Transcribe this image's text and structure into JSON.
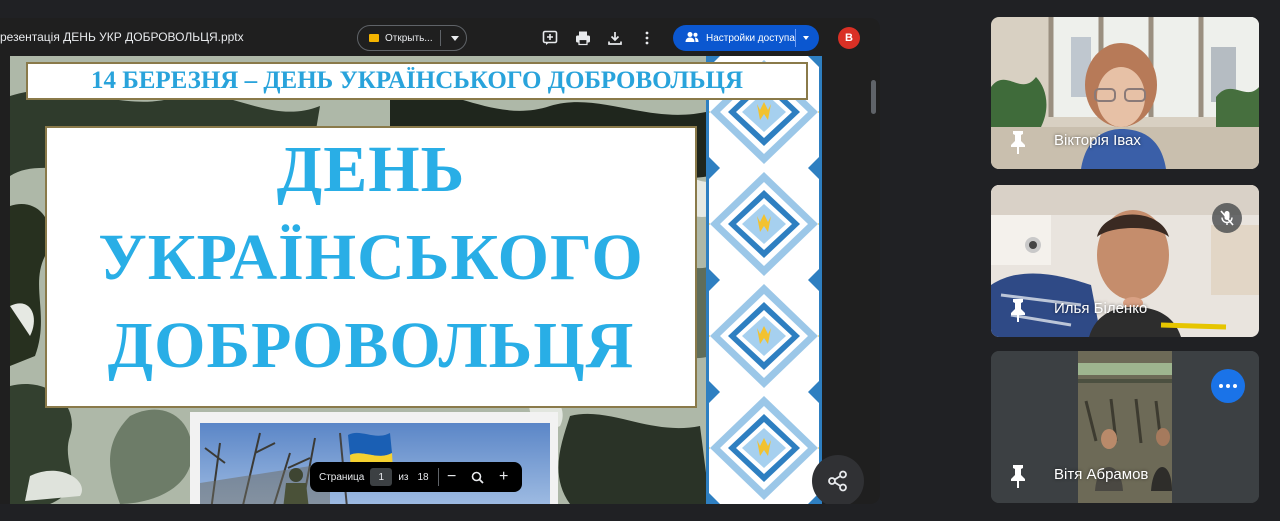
{
  "viewer": {
    "file_name": "резентація ДЕНЬ УКР ДОБРОВОЛЬЦЯ.pptx",
    "open_button_label": "Открыть...",
    "share_access_label": "Настройки доступа",
    "avatar_letter": "B",
    "icons": [
      "add-comment-icon",
      "print-icon",
      "download-icon",
      "more-vert-icon",
      "people-icon",
      "share-icon"
    ]
  },
  "slide": {
    "banner": "14 БЕРЕЗНЯ – ДЕНЬ УКРАЇНСЬКОГО ДОБРОВОЛЬЦЯ",
    "title_line_1": "ДЕНЬ",
    "title_line_2": "УКРАЇНСЬКОГО",
    "title_line_3": "ДОБРОВОЛЬЦЯ"
  },
  "page_control": {
    "label": "Страница",
    "current_page": "1",
    "of_label": "из",
    "total_pages": "18",
    "zoom_out": "−",
    "zoom_in": "+"
  },
  "participants": [
    {
      "name": "Вікторія Івах"
    },
    {
      "name": "Илья Біленко",
      "muted": true
    },
    {
      "name": "Вітя Абрамов"
    }
  ],
  "colors": {
    "accent": "#0b57d0",
    "title_blue": "#29aee6",
    "avatar_red": "#d93025",
    "more_button": "#1a73e8"
  }
}
